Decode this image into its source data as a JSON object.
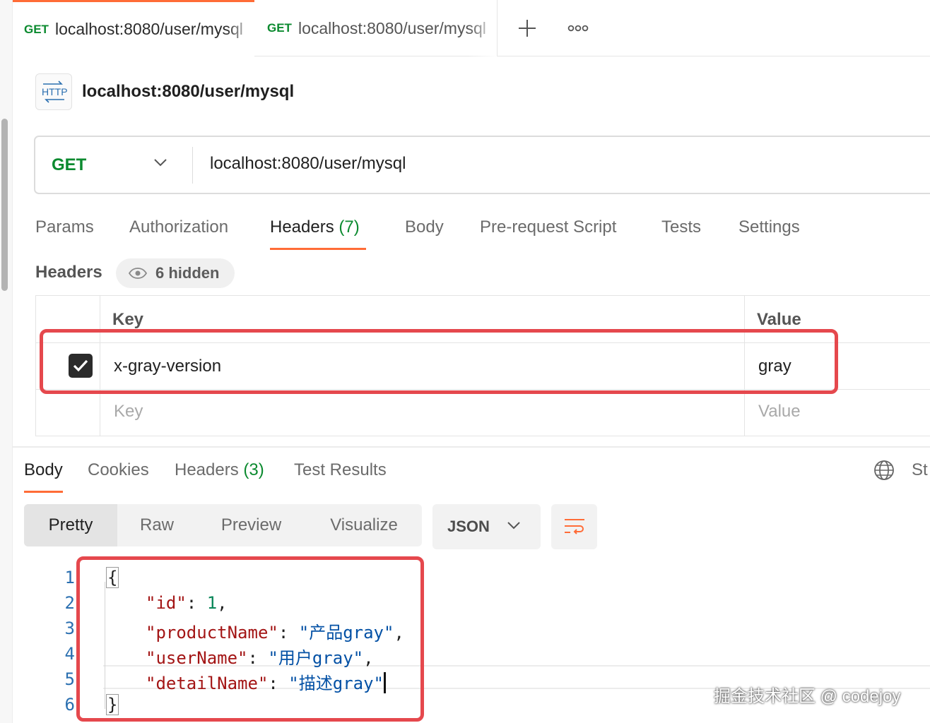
{
  "tabs": [
    {
      "method": "GET",
      "url": "localhost:8080/user/mysql"
    },
    {
      "method": "GET",
      "url": "localhost:8080/user/mysql"
    }
  ],
  "request": {
    "title": "localhost:8080/user/mysql",
    "method": "GET",
    "url": "localhost:8080/user/mysql"
  },
  "request_tabs": {
    "params": "Params",
    "authorization": "Authorization",
    "headers": "Headers",
    "headers_count": "(7)",
    "body": "Body",
    "prerequest": "Pre-request Script",
    "tests": "Tests",
    "settings": "Settings"
  },
  "headers_section": {
    "label": "Headers",
    "hidden_pill": "6 hidden",
    "col_key": "Key",
    "col_value": "Value",
    "rows": [
      {
        "checked": true,
        "key": "x-gray-version",
        "value": "gray"
      }
    ],
    "placeholder_key": "Key",
    "placeholder_value": "Value"
  },
  "response_tabs": {
    "body": "Body",
    "cookies": "Cookies",
    "headers": "Headers",
    "headers_count": "(3)",
    "test_results": "Test Results",
    "status_partial": "St"
  },
  "view_modes": {
    "pretty": "Pretty",
    "raw": "Raw",
    "preview": "Preview",
    "visualize": "Visualize"
  },
  "format": "JSON",
  "code": {
    "line_numbers": [
      "1",
      "2",
      "3",
      "4",
      "5",
      "6"
    ],
    "open_brace": "{",
    "close_brace": "}",
    "fields": [
      {
        "key": "\"id\"",
        "value": "1",
        "type": "number",
        "trail": ","
      },
      {
        "key": "\"productName\"",
        "value": "\"产品gray\"",
        "type": "string",
        "trail": ","
      },
      {
        "key": "\"userName\"",
        "value": "\"用户gray\"",
        "type": "string",
        "trail": ","
      },
      {
        "key": "\"detailName\"",
        "value": "\"描述gray\"",
        "type": "string",
        "trail": ""
      }
    ]
  },
  "watermark": "掘金技术社区 @ codejoy",
  "colors": {
    "accent": "#ff6c37",
    "method_get": "#0b8a2f",
    "highlight_box": "#e5484d"
  }
}
